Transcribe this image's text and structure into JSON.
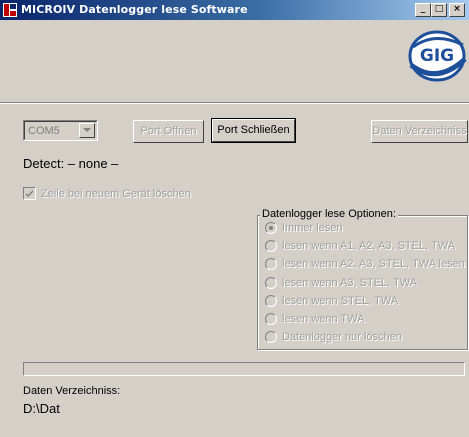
{
  "window": {
    "title": "MICROIV Datenlogger lese Software",
    "min_glyph": "_",
    "max_glyph": "□",
    "close_glyph": "×"
  },
  "logo": {
    "text": "GIG",
    "color": "#1e4f9a"
  },
  "port": {
    "selected": "COM5",
    "open_label": "Port Öffnen",
    "close_label": "Port Schließen",
    "data_dir_button": "Daten Verzeichniss"
  },
  "detect": {
    "text": "Detect:  – none –"
  },
  "checkbox": {
    "label": "Zeile bei neuem Gerät löschen",
    "checked": true
  },
  "options": {
    "title": "Datenlogger lese Optionen:",
    "items": [
      {
        "label": "Immer lesen",
        "selected": true
      },
      {
        "label": "lesen wenn A1, A2, A3, STEL, TWA",
        "selected": false
      },
      {
        "label": "lesen wenn A2, A3, STEL, TWA lesen",
        "selected": false
      },
      {
        "label": "lesen wenn A3, STEL, TWA",
        "selected": false
      },
      {
        "label": "lesen wenn STEL, TWA",
        "selected": false
      },
      {
        "label": "lesen wenn TWA",
        "selected": false
      },
      {
        "label": "Datenlogger nur löschen",
        "selected": false
      }
    ]
  },
  "progress": {
    "value": 0
  },
  "directory": {
    "label": "Daten Verzeichniss:",
    "value": "D:\\Dat"
  }
}
